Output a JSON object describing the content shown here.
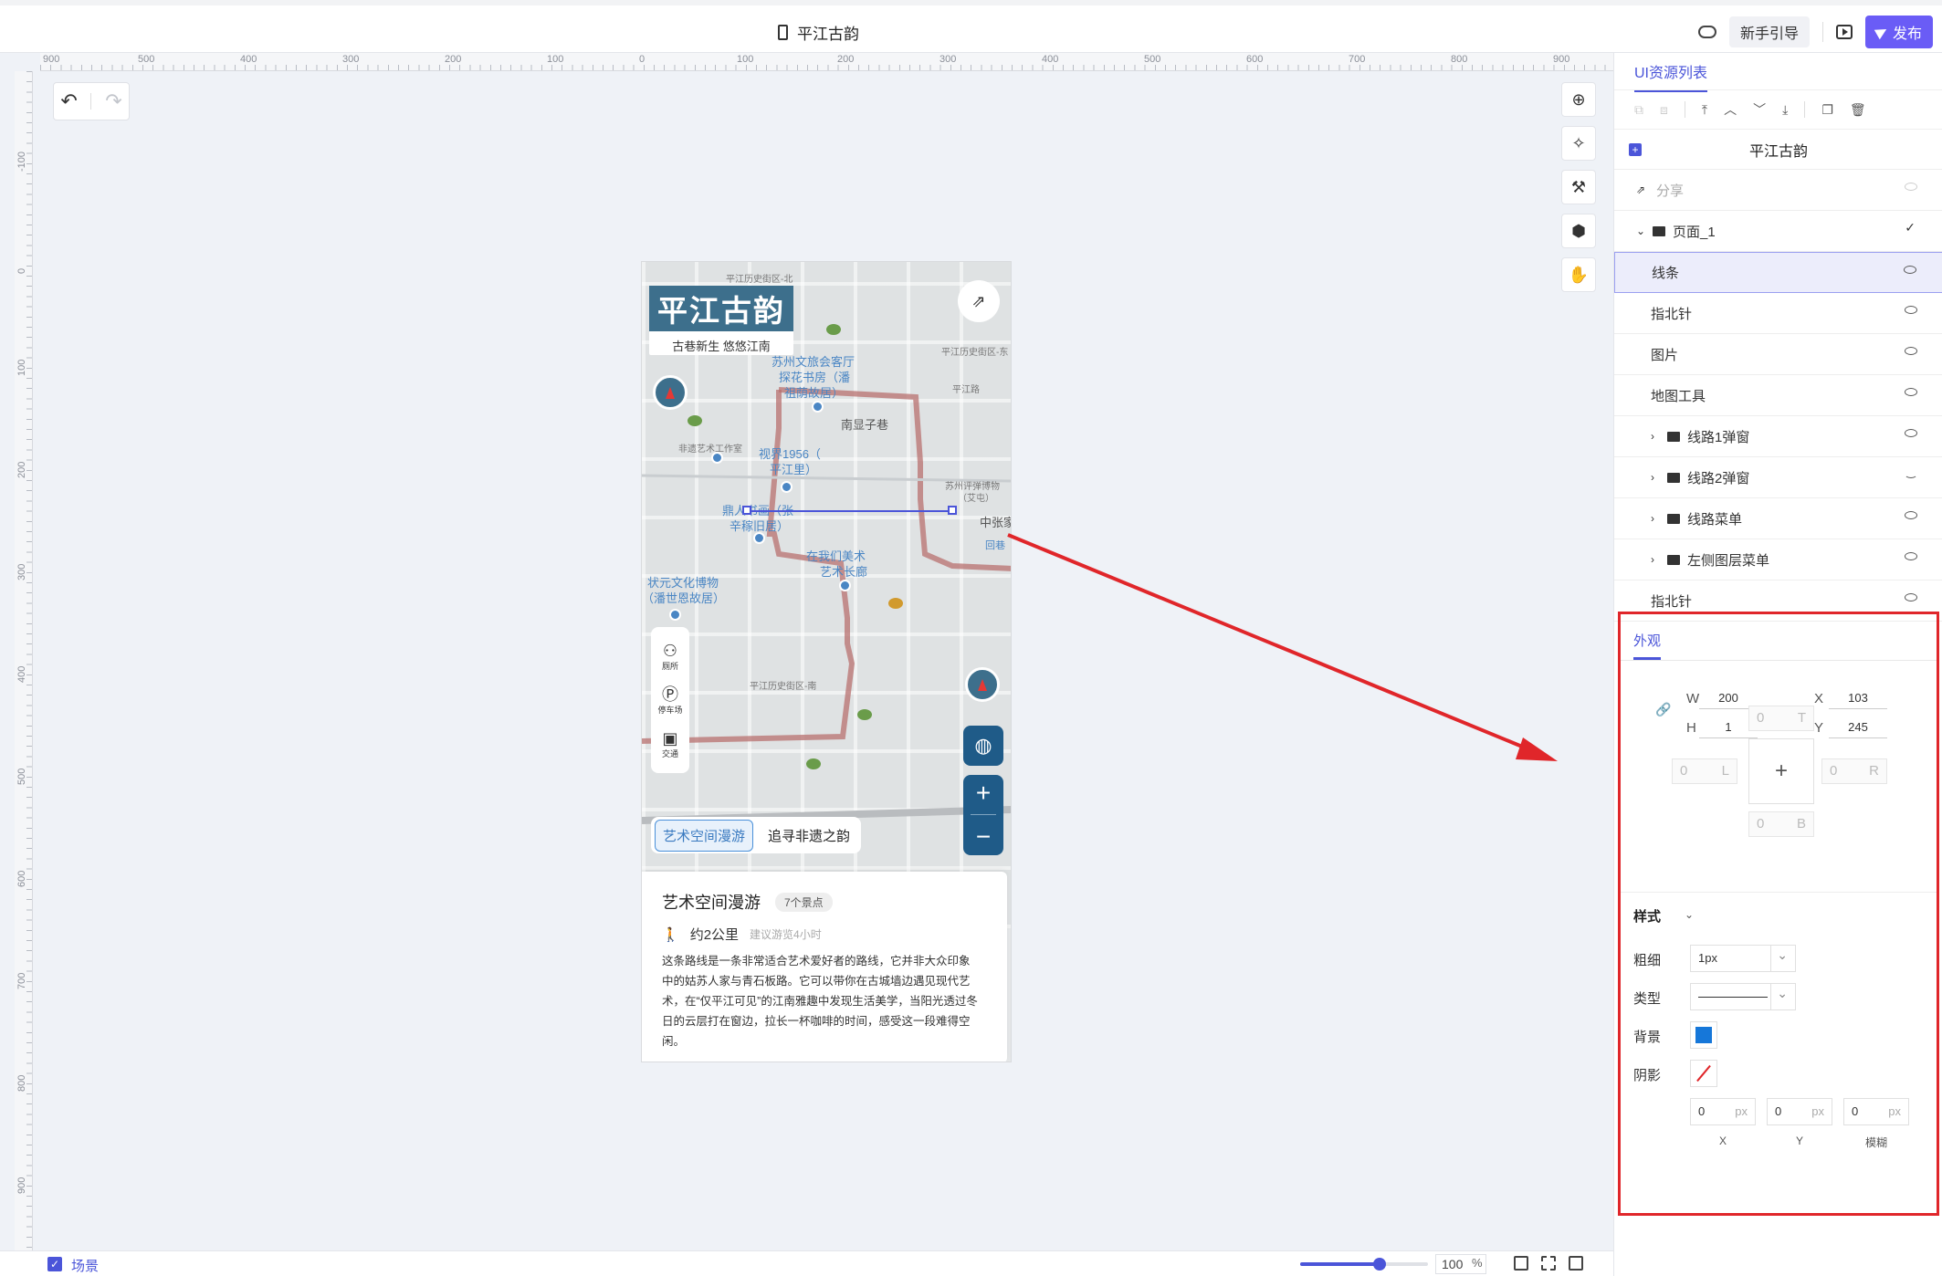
{
  "project": {
    "title": "平江古韵"
  },
  "toolbar": {
    "guide_label": "新手引导",
    "publish_label": "发布"
  },
  "ruler": {
    "top_ticks": [
      "900",
      "500",
      "400",
      "300",
      "200",
      "100",
      "0",
      "100",
      "200",
      "300",
      "400",
      "500",
      "600",
      "700",
      "800",
      "900"
    ],
    "left_ticks": [
      "-100",
      "0",
      "100",
      "200",
      "300",
      "400",
      "500",
      "600",
      "700",
      "800",
      "900"
    ]
  },
  "phone": {
    "app_title": "平江古韵",
    "app_subtitle": "古巷新生 悠悠江南",
    "map_labels": [
      "苏州文旅会客厅",
      "探花书房（潘",
      "祖荫故居）",
      "视界1956（",
      "平江里）",
      "鼎人书画（张",
      "辛稼旧居）",
      "在我们美术",
      "艺术长廊",
      "状元文化博物",
      "（潘世恩故居）",
      "南显子巷",
      "中张家",
      "回巷"
    ],
    "small_labels": [
      "平江历史街区-北",
      "平江历史街区-东",
      "非遗艺术工作室",
      "平江历史街区-南",
      "平江路",
      "苏州评弹博物",
      "（艾屯）"
    ],
    "facilities": [
      {
        "icon": "restroom-icon",
        "label": "厕所"
      },
      {
        "icon": "parking-icon",
        "label": "停车场"
      },
      {
        "icon": "transit-icon",
        "label": "交通"
      }
    ],
    "route_tabs": [
      {
        "label": "艺术空间漫游",
        "active": true
      },
      {
        "label": "追寻非遗之韵",
        "active": false
      }
    ],
    "card": {
      "title": "艺术空间漫游",
      "badge": "7个景点",
      "distance": "约2公里",
      "hint": "建议游览4小时",
      "description": "这条路线是一条非常适合艺术爱好者的路线，它并非大众印象中的姑苏人家与青石板路。它可以带你在古城墙边遇见现代艺术，在“仅平江可见”的江南雅趣中发现生活美学，当阳光透过冬日的云层打在窗边，拉长一杯咖啡的时间，感受这一段难得空闲。"
    }
  },
  "bottom": {
    "scene_label": "场景",
    "zoom_value": "100",
    "zoom_unit": "%",
    "zoom_fraction": 0.62
  },
  "panel": {
    "tab_label": "UI资源列表",
    "project_name": "平江古韵",
    "layers": [
      {
        "label": "分享",
        "muted": true,
        "eye": "open",
        "depth": 0
      },
      {
        "label": "页面_1",
        "folder": true,
        "expanded": true,
        "check": true,
        "depth": 0
      },
      {
        "label": "线条",
        "selected": true,
        "eye": "open",
        "depth": 1
      },
      {
        "label": "指北针",
        "eye": "open",
        "depth": 1
      },
      {
        "label": "图片",
        "eye": "open",
        "depth": 1
      },
      {
        "label": "地图工具",
        "eye": "open",
        "depth": 1
      },
      {
        "label": "线路1弹窗",
        "folder": true,
        "eye": "open",
        "depth": 1
      },
      {
        "label": "线路2弹窗",
        "folder": true,
        "eye": "closed",
        "depth": 1
      },
      {
        "label": "线路菜单",
        "folder": true,
        "eye": "open",
        "depth": 1
      },
      {
        "label": "左侧图层菜单",
        "folder": true,
        "eye": "open",
        "depth": 1
      },
      {
        "label": "指北针",
        "eye": "open",
        "depth": 1
      }
    ],
    "appearance": {
      "tab_label": "外观",
      "w_label": "W",
      "w_value": "200",
      "h_label": "H",
      "h_value": "1",
      "x_label": "X",
      "x_value": "103",
      "y_label": "Y",
      "y_value": "245",
      "spacing": {
        "top": {
          "value": "0",
          "label": "T"
        },
        "left": {
          "value": "0",
          "label": "L"
        },
        "right": {
          "value": "0",
          "label": "R"
        },
        "bottom": {
          "value": "0",
          "label": "B"
        }
      }
    },
    "style": {
      "heading": "样式",
      "weight_label": "粗细",
      "weight_value": "1px",
      "type_label": "类型",
      "bg_label": "背景",
      "bg_color": "#1677d9",
      "shadow_label": "阴影",
      "shadow_x": "0",
      "shadow_y": "0",
      "shadow_blur": "0",
      "shadow_unit": "px",
      "shadow_x_label": "X",
      "shadow_y_label": "Y",
      "shadow_blur_label": "模糊"
    }
  },
  "colors": {
    "accent": "#4b55d9",
    "highlight": "#e0262a",
    "map_blue": "#1f5b88",
    "title_bg": "#3d6f8c"
  }
}
